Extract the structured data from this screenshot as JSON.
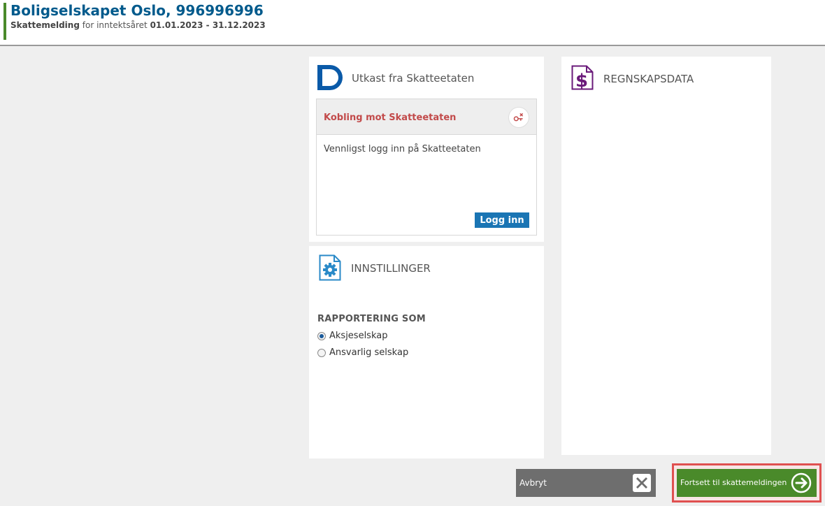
{
  "header": {
    "company": "Boligselskapet Oslo, 996996996",
    "form_name": "Skattemelding",
    "period_text": "for inntektsåret",
    "period": "01.01.2023 - 31.12.2023"
  },
  "utkast": {
    "title": "Utkast fra Skatteetaten",
    "kobling_title": "Kobling mot Skatteetaten",
    "message": "Vennligst logg inn på Skatteetaten",
    "login_label": "Logg inn"
  },
  "innstillinger": {
    "title": "INNSTILLINGER",
    "reporting_label": "RAPPORTERING SOM",
    "options": [
      {
        "label": "Aksjeselskap",
        "selected": true
      },
      {
        "label": "Ansvarlig selskap",
        "selected": false
      }
    ]
  },
  "regnskap": {
    "title": "REGNSKAPSDATA"
  },
  "actions": {
    "cancel_label": "Avbryt",
    "next_label": "Fortsett til skattemeldingen"
  },
  "colors": {
    "accent_blue": "#005a8c",
    "login_blue": "#1a75b4",
    "next_green": "#4a8a2a",
    "cancel_gray": "#6e6e6e",
    "kobling_red": "#c24a4a",
    "highlight_red": "#e05050"
  },
  "icons": {
    "utkast": "skatteetaten-logo-icon",
    "disconnect": "disconnect-icon",
    "innstillinger": "settings-document-icon",
    "regnskap": "dollar-document-icon",
    "cancel": "close-icon",
    "next": "arrow-right-circle-icon"
  }
}
